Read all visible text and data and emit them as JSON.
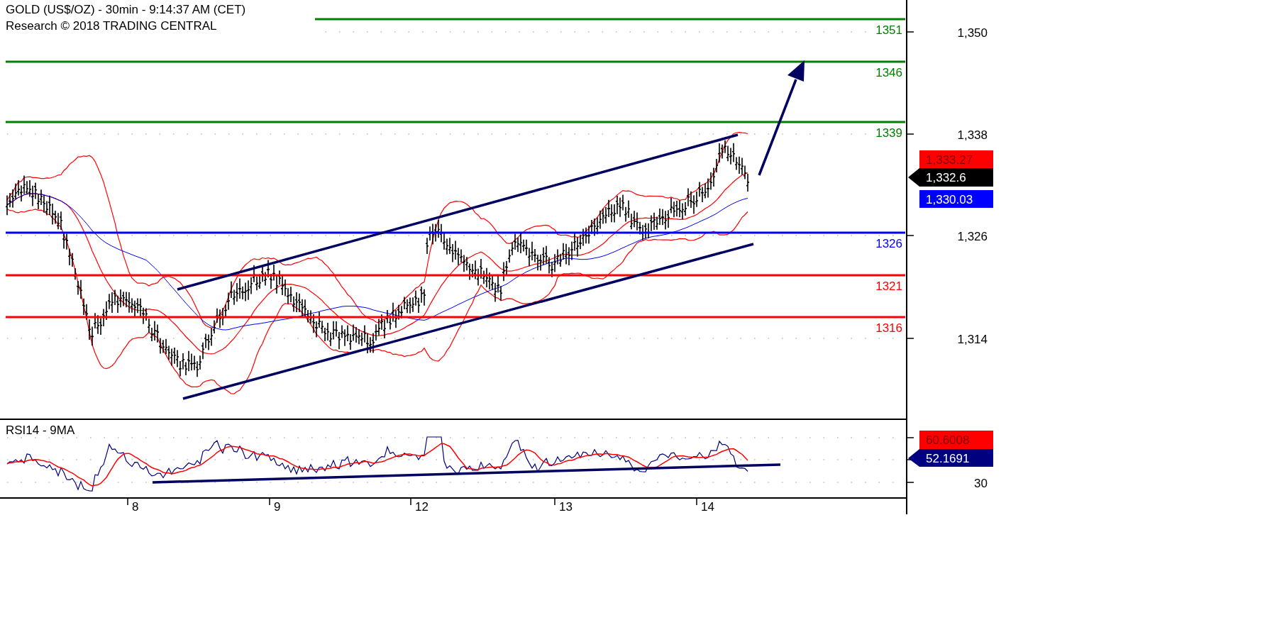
{
  "chart": {
    "title": "GOLD (US$/OZ) - 30min - 9:14:37 AM (CET)",
    "subtitle": "Research © 2018 TRADING CENTRAL",
    "levels": [
      {
        "label": "1351",
        "color": "#008000"
      },
      {
        "label": "1346",
        "color": "#008000"
      },
      {
        "label": "1339",
        "color": "#008000"
      },
      {
        "label": "1326",
        "color": "#0000ff"
      },
      {
        "label": "1321",
        "color": "#ff0000"
      },
      {
        "label": "1316",
        "color": "#ff0000"
      }
    ],
    "price_axis": [
      "1,350",
      "1,338",
      "1,326",
      "1,314"
    ],
    "price_tags": [
      {
        "text": "1,333.27",
        "color": "#ff0000",
        "kind": "box"
      },
      {
        "text": "1,332.6",
        "color": "#000000",
        "kind": "pointer"
      },
      {
        "text": "1,330.03",
        "color": "#0000ff",
        "kind": "box"
      }
    ]
  },
  "rsi": {
    "title": "RSI14 - 9MA",
    "axis": [
      "30"
    ],
    "tags": [
      {
        "text": "60.6008",
        "color": "#ff0000",
        "kind": "box"
      },
      {
        "text": "52.1691",
        "color": "#000080",
        "kind": "pointer"
      }
    ]
  },
  "dates": [
    "8",
    "9",
    "12",
    "13",
    "14"
  ]
}
